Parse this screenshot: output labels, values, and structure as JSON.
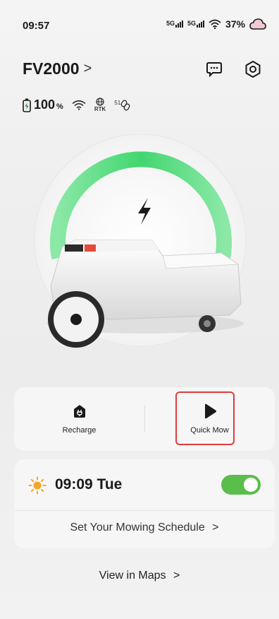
{
  "status_bar": {
    "time": "09:57",
    "network_1": "5G",
    "network_2": "5G",
    "battery": "37%"
  },
  "header": {
    "device_name": "FV2000",
    "chevron": ">",
    "message_icon": "message-icon",
    "settings_icon": "settings-icon"
  },
  "device_status": {
    "battery_value": "100",
    "battery_unit": "%",
    "rtk_label": "RTK",
    "link_label": "51"
  },
  "hero": {
    "charge_level": 1.0,
    "accent_color": "#4cd97a"
  },
  "actions": {
    "recharge_label": "Recharge",
    "quick_mow_label": "Quick Mow"
  },
  "schedule": {
    "time": "09:09 Tue",
    "enabled": true,
    "link_label": "Set Your Mowing Schedule",
    "link_chevron": ">"
  },
  "maps": {
    "label": "View in Maps",
    "chevron": ">"
  },
  "colors": {
    "highlight": "#e23a3a",
    "toggle_on": "#5bbd4b",
    "sun": "#f5a623"
  }
}
